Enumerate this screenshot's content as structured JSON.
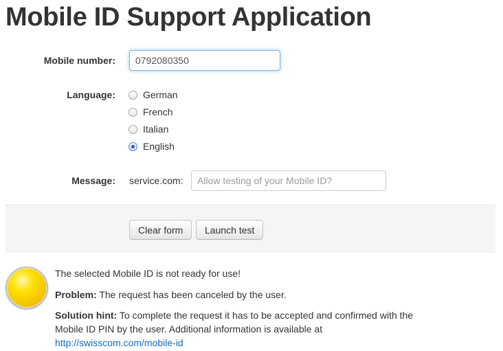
{
  "page": {
    "title": "Mobile ID Support Application"
  },
  "form": {
    "mobile_label": "Mobile number:",
    "mobile_value": "0792080350",
    "language_label": "Language:",
    "languages": [
      {
        "label": "German",
        "checked": false
      },
      {
        "label": "French",
        "checked": false
      },
      {
        "label": "Italian",
        "checked": false
      },
      {
        "label": "English",
        "checked": true
      }
    ],
    "message_label": "Message:",
    "message_prefix": "service.com:",
    "message_placeholder": "Allow testing of your Mobile ID?"
  },
  "actions": {
    "clear_label": "Clear form",
    "launch_label": "Launch test"
  },
  "result": {
    "status_color": "#ffe000",
    "status_icon": "yellow-status-icon",
    "headline": "The selected Mobile ID is not ready for use!",
    "problem_label": "Problem:",
    "problem_text": " The request has been canceled by the user.",
    "hint_label": "Solution hint:",
    "hint_text": " To complete the request it has to be accepted and confirmed with the Mobile ID PIN by the user. Additional information is available at ",
    "hint_link": "http://swisscom.com/mobile-id"
  }
}
